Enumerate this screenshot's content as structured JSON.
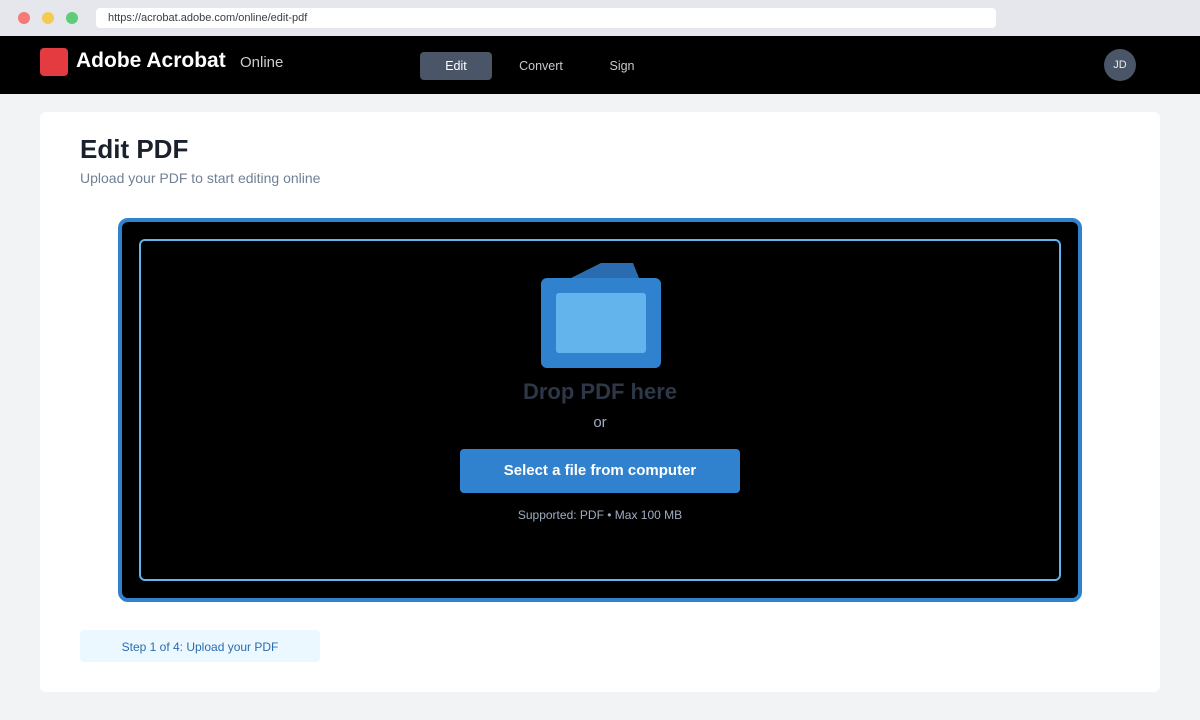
{
  "browser": {
    "url": "https://acrobat.adobe.com/online/edit-pdf"
  },
  "header": {
    "brand": "Adobe Acrobat",
    "brand_sub": "Online",
    "tabs": [
      {
        "label": "Edit",
        "active": true
      },
      {
        "label": "Convert",
        "active": false
      },
      {
        "label": "Sign",
        "active": false
      }
    ],
    "avatar_initials": "JD"
  },
  "main": {
    "title": "Edit PDF",
    "subtitle": "Upload your PDF to start editing online",
    "dropzone": {
      "icon": "folder-icon",
      "title": "Drop PDF here",
      "or_text": "or",
      "button_label": "Select a file from computer",
      "supported_text": "Supported: PDF • Max 100 MB"
    },
    "step_text": "Step 1 of 4: Upload your PDF"
  },
  "colors": {
    "accent": "#3182ce",
    "brand_red": "#e33b3f",
    "header_bg": "#000000"
  }
}
